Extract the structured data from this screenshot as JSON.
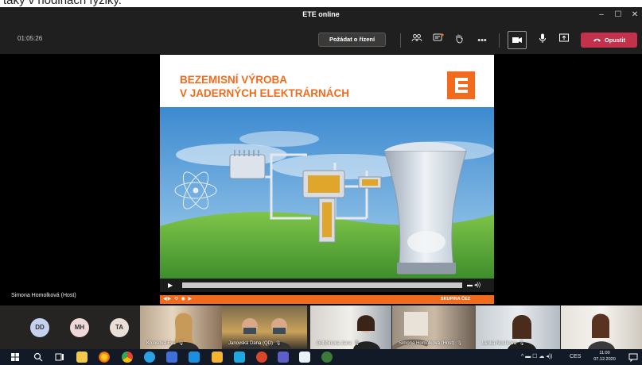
{
  "top_caption": "taky v hodinách fyziky.",
  "window": {
    "title": "ETE online",
    "minimize": "–",
    "maximize": "☐",
    "close": "✕"
  },
  "toolbar": {
    "timer": "01:05:26",
    "request_control_label": "Požádat o řízení",
    "more_label": "•••",
    "leave_label": "Opustit"
  },
  "slide": {
    "title_line1": "BEZEMISNÍ VÝROBA",
    "title_line2": "V JADERNÝCH ELEKTRÁRNÁCH",
    "footer_brand": "SKUPINA ČEZ",
    "progress": 0.0
  },
  "presenter_label": "Simona Homolková (Host)",
  "participants": {
    "avatars": [
      {
        "initials": "DD",
        "color": "#c5d2ef"
      },
      {
        "initials": "MH",
        "color": "#f0d8d8"
      },
      {
        "initials": "TA",
        "color": "#eadfd6"
      }
    ],
    "tiles": [
      {
        "name": "Kruliśová Eva"
      },
      {
        "name": "Janovská Dana (QD)"
      },
      {
        "name": "Gribbinová Jana"
      },
      {
        "name": "Simona Homolková (Host)"
      },
      {
        "name": "Lenka Nosíková"
      },
      {
        "name": ""
      }
    ]
  },
  "taskbar": {
    "language": "CES",
    "time": "11:00",
    "date": "07.12.2020"
  },
  "colors": {
    "accent_orange": "#f26b1d",
    "leave_red": "#c4314b",
    "chrome_dark": "#201f1f"
  }
}
